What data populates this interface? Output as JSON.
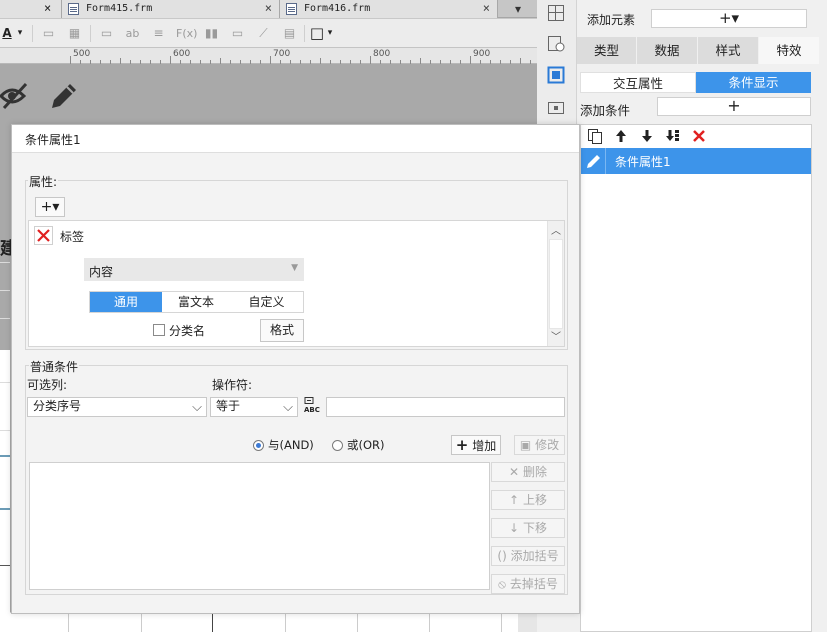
{
  "tabs": [
    {
      "name": "Form415.frm",
      "close": "×"
    },
    {
      "name": "Form416.frm",
      "close": "×"
    }
  ],
  "ruler": [
    "500",
    "600",
    "700",
    "800",
    "900"
  ],
  "canvas": {
    "partial_char": "建",
    "left_marks": [
      "—",
      "—",
      "—"
    ]
  },
  "right_panel": {
    "add_element_label": "添加元素",
    "add_element_button": "+▾",
    "tabs": [
      "类型",
      "数据",
      "样式",
      "特效"
    ],
    "active_tab": "特效",
    "subtabs": [
      "交互属性",
      "条件显示"
    ],
    "active_subtab": "条件显示",
    "add_condition_label": "添加条件",
    "add_condition_button": "+",
    "condition_items": [
      "条件属性1"
    ]
  },
  "dialog": {
    "title": "条件属性1",
    "attr_group_label": "属性:",
    "attr_add_button": "+▾",
    "attr_row_label": "标签",
    "content_select": "内容",
    "segments": [
      "通用",
      "富文本",
      "自定义"
    ],
    "active_segment": "通用",
    "category_checkbox_label": "分类名",
    "format_button": "格式",
    "cond_group_label": "普通条件",
    "column_label": "可选列:",
    "operator_label": "操作符:",
    "column_value": "分类序号",
    "operator_value": "等于",
    "formula_icon_text": "ABC",
    "radio_and": "与(AND)",
    "radio_or": "或(OR)",
    "add_button": "增加",
    "modify_button": "修改",
    "delete_button": "删除",
    "up_button": "上移",
    "down_button": "下移",
    "add_bracket_button": "添加括号",
    "remove_bracket_button": "去掉括号"
  },
  "colors": {
    "accent": "#3d94ea",
    "delete_red": "#e02020"
  }
}
